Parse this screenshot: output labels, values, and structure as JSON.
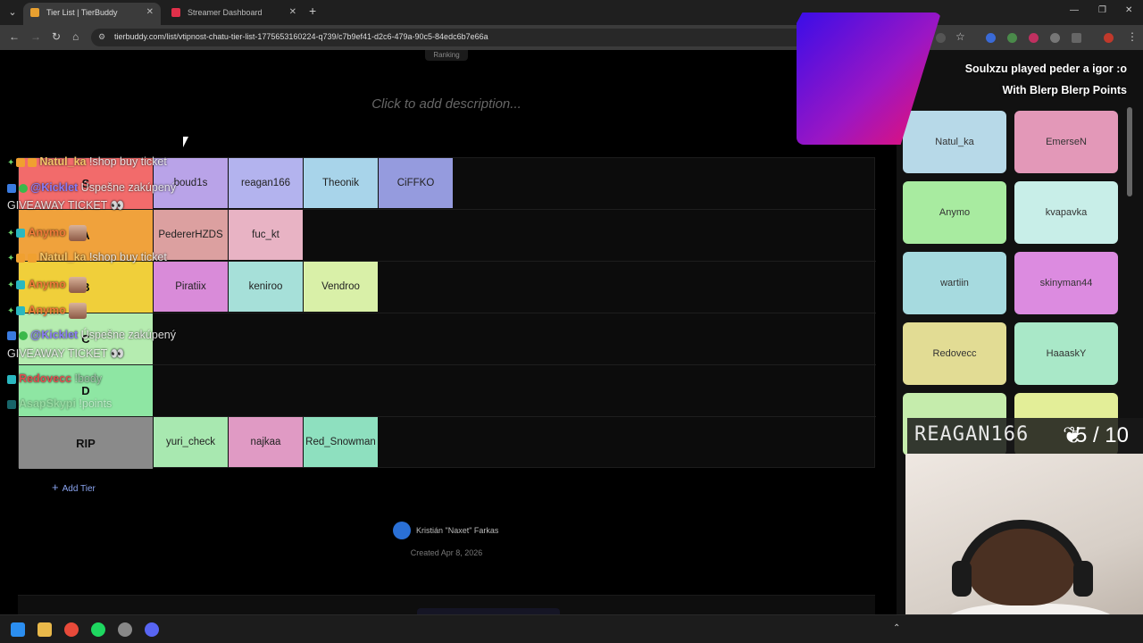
{
  "browser": {
    "tabs": [
      {
        "title": "Tier List | TierBuddy",
        "active": true
      },
      {
        "title": "Streamer Dashboard",
        "active": false
      }
    ],
    "url": "tierbuddy.com/list/vtipnost-chatu-tier-list-1775653160224-q739/c7b9ef41-d2c6-479a-90c5-84edc6b7e66a"
  },
  "page": {
    "ranking_label": "Ranking",
    "description_placeholder": "Click to add description...",
    "add_tier_label": "Add Tier",
    "author": "Kristián \"Naxet\" Farkas",
    "created": "Created Apr 8, 2026"
  },
  "tiers": [
    {
      "label": "S",
      "color": "#f26b6b",
      "items": [
        {
          "name": "boud1s",
          "color": "#b9a3e8"
        },
        {
          "name": "reagan166",
          "color": "#b3b3ee"
        },
        {
          "name": "Theonik",
          "color": "#a8d4ea"
        },
        {
          "name": "CiFFKO",
          "color": "#959bde"
        }
      ]
    },
    {
      "label": "A",
      "color": "#f0a23c",
      "items": [
        {
          "name": "PedererHZDS",
          "color": "#dca0a0"
        },
        {
          "name": "fuc_kt",
          "color": "#e8b3c4"
        }
      ]
    },
    {
      "label": "B",
      "color": "#f0cf3a",
      "items": [
        {
          "name": "Piratiix",
          "color": "#d98bd9"
        },
        {
          "name": "keniroo",
          "color": "#a6e0d9"
        },
        {
          "name": "Vendroo",
          "color": "#d9f0a8"
        }
      ]
    },
    {
      "label": "C",
      "color": "#b5ecb0",
      "items": []
    },
    {
      "label": "D",
      "color": "#8ee6a3",
      "items": []
    },
    {
      "label": "RIP",
      "color": "#8a8a8a",
      "items": [
        {
          "name": "yuri_check",
          "color": "#a8e8b0"
        },
        {
          "name": "najkaa",
          "color": "#e09ac4"
        },
        {
          "name": "Red_Snowman",
          "color": "#8ee0bf"
        }
      ]
    }
  ],
  "chat": [
    {
      "user": "Natul_ka",
      "message": "!shop buy ticket",
      "user_color": "#f5c56a"
    },
    {
      "user": "@Kicklet",
      "message": "Úspešne zakúpený",
      "user_color": "#8a7cf5",
      "line2": "GIVEAWAY TICKET 👀"
    },
    {
      "user": "Anymo",
      "message": "",
      "user_color": "#f07a3a"
    },
    {
      "user": "Natul_ka",
      "message": "!shop buy ticket",
      "user_color": "#f5c56a"
    },
    {
      "user": "Anymo",
      "message": "",
      "user_color": "#f07a3a"
    },
    {
      "user": "Anymo",
      "message": "",
      "user_color": "#f07a3a"
    },
    {
      "user": "@Kicklet",
      "message": "Úspešne zakúpený",
      "user_color": "#8a7cf5",
      "line2": "GIVEAWAY TICKET 👀"
    },
    {
      "user": "Redovecc",
      "message": "!body",
      "user_color": "#e05050"
    },
    {
      "user": "AsapSkypi",
      "message": "!points",
      "user_color": "#a0d0a0"
    }
  ],
  "alert": {
    "line1": "Soulxzu played peder a igor :o",
    "line2": "With Blerp Blerp Points"
  },
  "pool": [
    {
      "name": "Natul_ka",
      "color": "#b7d9e8"
    },
    {
      "name": "EmerseN",
      "color": "#e398b8"
    },
    {
      "name": "Anymo",
      "color": "#a8eba0"
    },
    {
      "name": "kvapavka",
      "color": "#c8eee8"
    },
    {
      "name": "wartiin",
      "color": "#a6dadf"
    },
    {
      "name": "skinyman44",
      "color": "#dc8be0"
    },
    {
      "name": "Redovecc",
      "color": "#e2dc94"
    },
    {
      "name": "HaaaskY",
      "color": "#a9e8c8"
    },
    {
      "name": "",
      "color": "#c5ecac"
    },
    {
      "name": "",
      "color": "#e3ee98"
    }
  ],
  "overlay": {
    "current_name": "REAGAN166",
    "score": "5 / 10"
  }
}
